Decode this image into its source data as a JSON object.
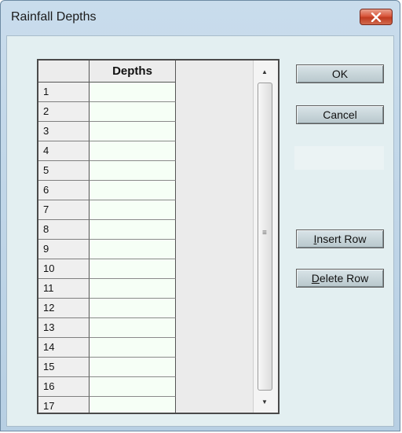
{
  "window": {
    "title": "Rainfall Depths"
  },
  "grid": {
    "column_header": "Depths",
    "rows": [
      "1",
      "2",
      "3",
      "4",
      "5",
      "6",
      "7",
      "8",
      "9",
      "10",
      "11",
      "12",
      "13",
      "14",
      "15",
      "16",
      "17"
    ]
  },
  "buttons": {
    "ok": "OK",
    "cancel": "Cancel",
    "insert_row_mnemonic": "I",
    "insert_row_rest": "nsert Row",
    "delete_row_mnemonic": "D",
    "delete_row_rest": "elete Row"
  },
  "colors": {
    "close_button": "#d9573c",
    "cell_background": "#f6fff6",
    "dialog_background": "#e3eff1"
  },
  "icons": {
    "close": "close-icon",
    "scroll_up": "arrow-up-icon",
    "scroll_down": "arrow-down-icon",
    "grip": "grip-icon"
  }
}
